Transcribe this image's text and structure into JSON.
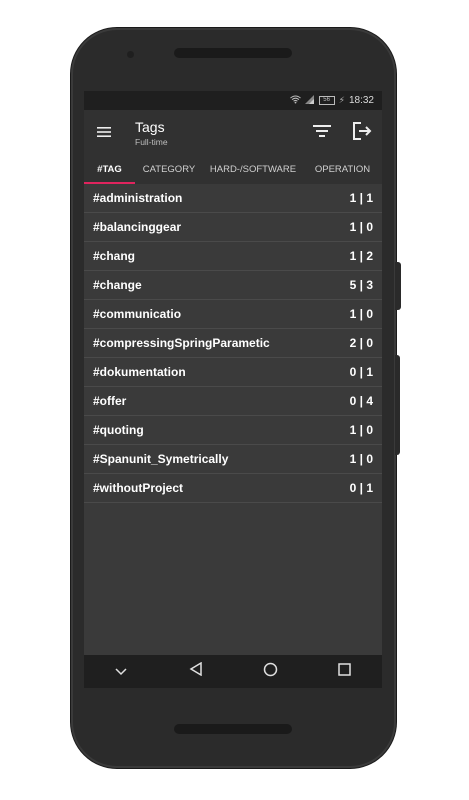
{
  "status_bar": {
    "battery": "56",
    "time": "18:32"
  },
  "app_bar": {
    "title": "Tags",
    "subtitle": "Full-time",
    "menu_icon": "menu-icon",
    "sort_icon": "sort-icon",
    "exit_icon": "exit-icon"
  },
  "tabs": [
    {
      "label": "#TAG",
      "selected": true
    },
    {
      "label": "CATEGORY",
      "selected": false
    },
    {
      "label": "HARD-/SOFTWARE",
      "selected": false
    },
    {
      "label": "OPERATION",
      "selected": false
    }
  ],
  "tags": [
    {
      "name": "#administration",
      "count": "1 | 1"
    },
    {
      "name": "#balancinggear",
      "count": "1 | 0"
    },
    {
      "name": "#chang",
      "count": "1 | 2"
    },
    {
      "name": "#change",
      "count": "5 | 3"
    },
    {
      "name": "#communicatio",
      "count": "1 | 0"
    },
    {
      "name": "#compressingSpringParametic",
      "count": "2 | 0"
    },
    {
      "name": "#dokumentation",
      "count": "0 | 1"
    },
    {
      "name": "#offer",
      "count": "0 | 4"
    },
    {
      "name": "#quoting",
      "count": "1 | 0"
    },
    {
      "name": "#Spanunit_Symetrically",
      "count": "1 | 0"
    },
    {
      "name": "#withoutProject",
      "count": "0 | 1"
    }
  ],
  "colors": {
    "accent": "#e0245e",
    "background": "#3a3a3a",
    "appbar": "#313131"
  },
  "navigation_bar": [
    "chevron-down-icon",
    "back-icon",
    "home-icon",
    "recents-icon"
  ]
}
